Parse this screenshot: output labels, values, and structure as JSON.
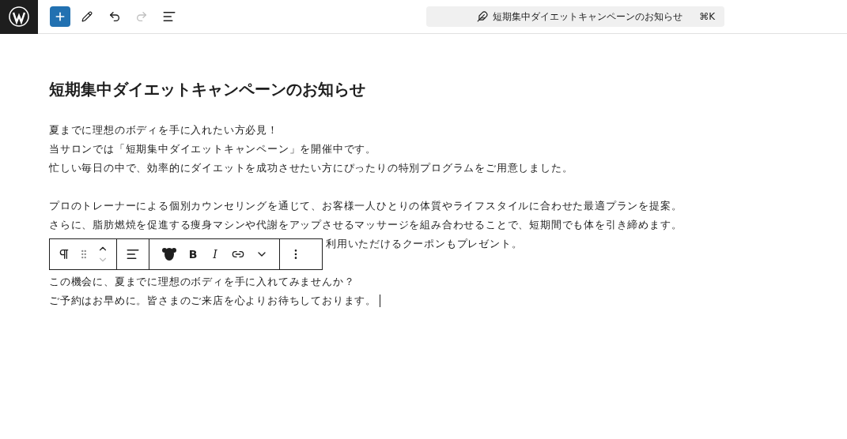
{
  "topbar": {
    "undo_disabled": false,
    "redo_disabled": true,
    "document_title": "短期集中ダイエットキャンペーンのお知らせ",
    "shortcut": "⌘K"
  },
  "post": {
    "title": "短期集中ダイエットキャンペーンのお知らせ",
    "blocks": [
      {
        "lines": [
          {
            "kind": "full",
            "text": "夏までに理想のボディを手に入れたい方必見！"
          },
          {
            "kind": "full",
            "text": "当サロンでは「短期集中ダイエットキャンペーン」を開催中です。"
          },
          {
            "kind": "full",
            "text": "忙しい毎日の中で、効率的にダイエットを成功させたい方にぴったりの特別プログラムをご用意しました。"
          }
        ],
        "caret": false
      },
      {
        "lines": [
          {
            "kind": "full",
            "text": "プロのトレーナーによる個別カウンセリングを通じて、お客様一人ひとりの体質やライフスタイルに合わせた最適プランを提案。"
          },
          {
            "kind": "full",
            "text": "さらに、脂肪燃焼を促進する痩身マシンや代謝をアップさせるマッサージを組み合わせることで、短期間でも体を引き締めます。"
          },
          {
            "kind": "covered",
            "text": "利用いただけるクーポンもプレゼント。"
          }
        ],
        "caret": false
      },
      {
        "lines": [
          {
            "kind": "full",
            "text": "この機会に、夏までに理想のボディを手に入れてみませんか？"
          },
          {
            "kind": "full",
            "text": "ご予約はお早めに。皆さまのご来店を心よりお待ちしております。"
          }
        ],
        "caret": true
      }
    ]
  },
  "block_toolbar": {
    "bold": "B",
    "italic": "I",
    "move_down_disabled": true
  }
}
